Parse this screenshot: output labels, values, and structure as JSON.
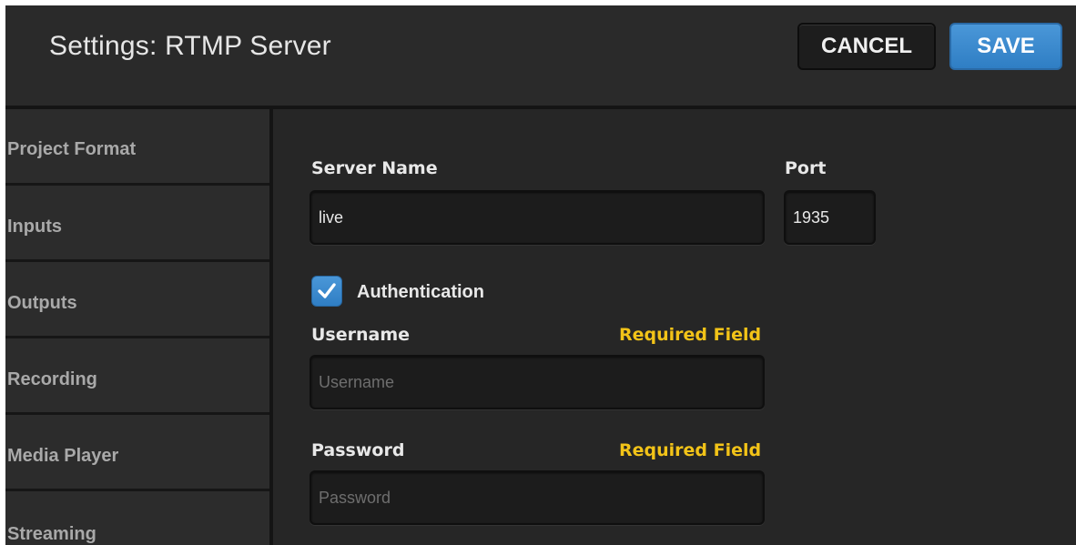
{
  "header": {
    "title": "Settings: RTMP Server",
    "cancel_label": "CANCEL",
    "save_label": "SAVE"
  },
  "sidebar": {
    "items": [
      {
        "label": "Project Format"
      },
      {
        "label": "Inputs"
      },
      {
        "label": "Outputs"
      },
      {
        "label": "Recording"
      },
      {
        "label": "Media Player"
      },
      {
        "label": "Streaming"
      }
    ]
  },
  "form": {
    "server_name": {
      "label": "Server Name",
      "value": "live"
    },
    "port": {
      "label": "Port",
      "value": "1935"
    },
    "authentication": {
      "label": "Authentication",
      "checked": true
    },
    "username": {
      "label": "Username",
      "required_text": "Required Field",
      "value": "",
      "placeholder": "Username"
    },
    "password": {
      "label": "Password",
      "required_text": "Required Field",
      "value": "",
      "placeholder": "Password"
    }
  },
  "colors": {
    "accent": "#3d8bd1",
    "required": "#f2c318",
    "background": "#262626"
  },
  "icons": {
    "checkbox": "checkmark-icon"
  }
}
